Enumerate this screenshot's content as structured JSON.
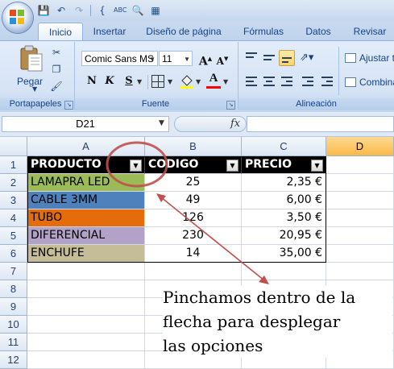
{
  "quick_access": {
    "icons": [
      "save-icon",
      "undo-icon",
      "redo-icon",
      "brace-icon",
      "spellcheck-icon",
      "print-preview-icon",
      "calculator-icon"
    ]
  },
  "tabs": [
    {
      "label": "Inicio",
      "active": true
    },
    {
      "label": "Insertar",
      "active": false
    },
    {
      "label": "Diseño de página",
      "active": false
    },
    {
      "label": "Fórmulas",
      "active": false
    },
    {
      "label": "Datos",
      "active": false
    },
    {
      "label": "Revisar",
      "active": false
    }
  ],
  "ribbon": {
    "clipboard": {
      "paste_label": "Pegar",
      "group_label": "Portapapeles"
    },
    "font": {
      "font_name": "Comic Sans MS",
      "font_size": "11",
      "grow_label": "A",
      "shrink_label": "A",
      "bold": "N",
      "italic": "K",
      "underline": "S",
      "font_color_label": "A",
      "group_label": "Fuente"
    },
    "alignment": {
      "wrap_label": "Ajustar t",
      "merge_label": "Combina",
      "group_label": "Alineación"
    }
  },
  "formula_bar": {
    "name_box": "D21",
    "fx": "fx",
    "formula": ""
  },
  "sheet": {
    "columns": [
      "A",
      "B",
      "C",
      "D"
    ],
    "rows": [
      "1",
      "2",
      "3",
      "4",
      "5",
      "6",
      "7",
      "8",
      "9",
      "10",
      "11",
      "12"
    ],
    "selected_column": "D",
    "headers": [
      "PRODUCTO",
      "CODIGO",
      "PRECIO"
    ],
    "data": [
      {
        "producto": "LAMAPRA LED",
        "codigo": "25",
        "precio": "2,35 €",
        "color": "#9bbb59"
      },
      {
        "producto": "CABLE 3MM",
        "codigo": "49",
        "precio": "6,00 €",
        "color": "#4f81bd"
      },
      {
        "producto": "TUBO",
        "codigo": "126",
        "precio": "3,50 €",
        "color": "#e46c0a"
      },
      {
        "producto": "DIFERENCIAL",
        "codigo": "230",
        "precio": "20,95 €",
        "color": "#b3a2c7"
      },
      {
        "producto": "ENCHUFE",
        "codigo": "14",
        "precio": "35,00 €",
        "color": "#c4bd97"
      }
    ]
  },
  "annotation": {
    "lines": [
      "Pinchamos dentro de la",
      "flecha para desplegar",
      "las opciones"
    ],
    "color": "#c0504d"
  }
}
